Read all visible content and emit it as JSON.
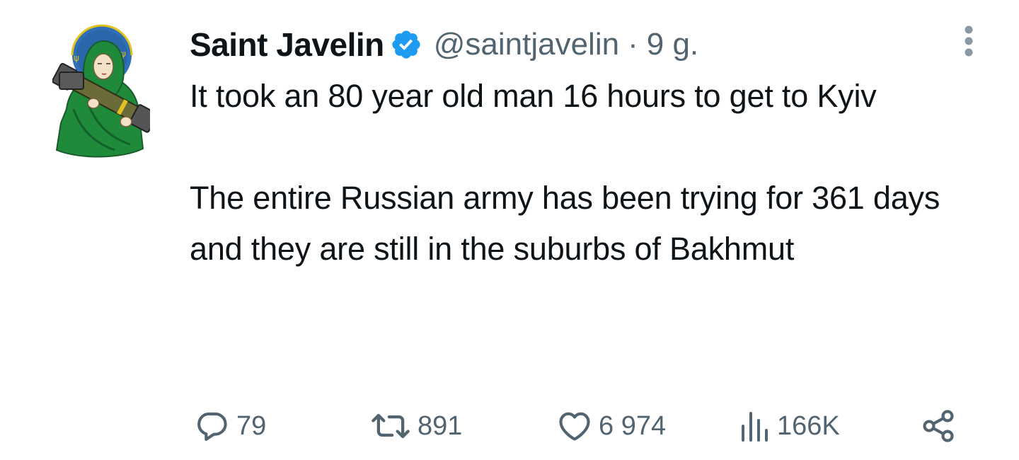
{
  "tweet": {
    "display_name": "Saint Javelin",
    "verified": true,
    "handle": "@saintjavelin",
    "separator": "·",
    "time": "9 g.",
    "text_lines": [
      "It took an 80 year old man 16 hours to get to Kyiv",
      "The entire Russian army has been trying for 361 days and they are still in the suburbs of Bakhmut"
    ]
  },
  "actions": {
    "replies": "79",
    "retweets": "891",
    "likes": "6 974",
    "views": "166K"
  },
  "icons": {
    "avatar": "saint-javelin-avatar",
    "verified": "verified-badge-icon",
    "more": "more-options-icon",
    "reply": "reply-icon",
    "retweet": "retweet-icon",
    "like": "heart-icon",
    "views": "views-icon",
    "share": "share-icon"
  },
  "colors": {
    "text": "#0f1419",
    "secondary": "#536471",
    "verified": "#1d9bf0",
    "avatar_green": "#1e8a3a",
    "avatar_blue": "#2f6fb5",
    "avatar_gold": "#e2c21f"
  }
}
